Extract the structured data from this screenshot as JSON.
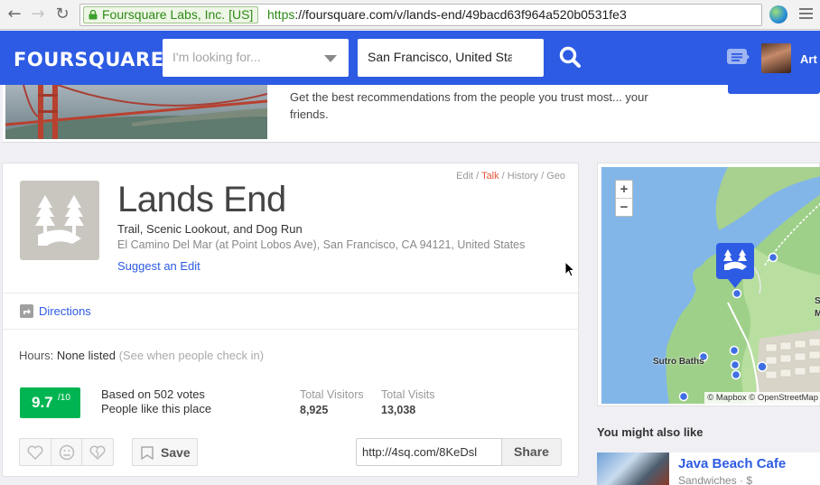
{
  "browser": {
    "ev_org": "Foursquare Labs, Inc. [US]",
    "url_scheme": "https",
    "url_rest": "://foursquare.com/v/lands-end/49bacd63f964a520b0531fe3"
  },
  "header": {
    "logo": "FOURSQUARE",
    "search_placeholder": "I'm looking for...",
    "location_value": "San Francisco, United States",
    "user_name": "Art",
    "brand_color": "#2d5be3"
  },
  "banner": {
    "text": "Get the best recommendations from the people you trust most... your friends."
  },
  "venue": {
    "name": "Lands End",
    "categories": "Trail, Scenic Lookout, and Dog Run",
    "address": "El Camino Del Mar (at Point Lobos Ave), San Francisco, CA 94121, United States",
    "suggest_edit": "Suggest an Edit",
    "edit_links": {
      "edit": "Edit",
      "talk": "Talk",
      "history": "History",
      "geo": "Geo",
      "sep": " / "
    },
    "directions": "Directions",
    "hours_label": "Hours:",
    "hours_value": "None listed",
    "hours_hint": "(See when people check in)",
    "score": "9.7",
    "score_denominator": "/10",
    "votes_line1": "Based on 502 votes",
    "votes_line2": "People like this place",
    "visitors_label": "Total Visitors",
    "visitors_value": "8,925",
    "visits_label": "Total Visits",
    "visits_value": "13,038",
    "save_label": "Save",
    "share_url": "http://4sq.com/8KeDsl",
    "share_label": "Share",
    "score_color": "#00b551"
  },
  "map": {
    "zoom_in": "+",
    "zoom_out": "−",
    "poi_label": "Sutro Baths",
    "edge_label": "S M",
    "attribution": "© Mapbox © OpenStreetMap"
  },
  "also_like": {
    "title": "You might also like",
    "items": [
      {
        "name": "Java Beach Cafe",
        "subtitle": "Sandwiches · $"
      }
    ]
  }
}
